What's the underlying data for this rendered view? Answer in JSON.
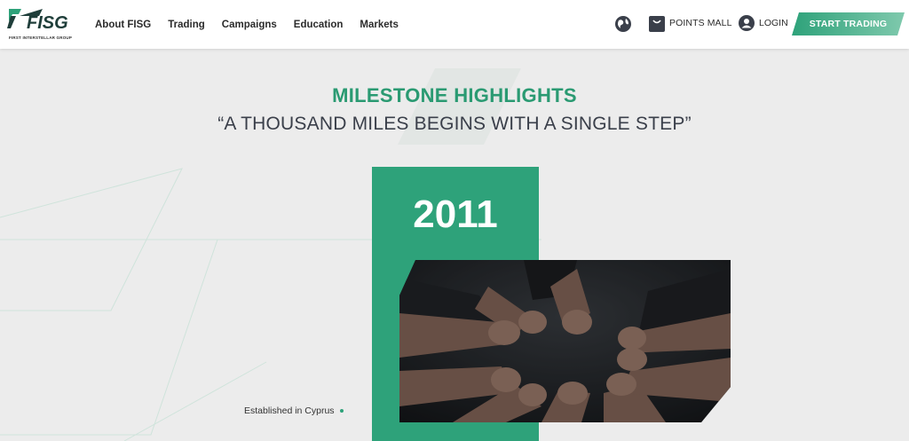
{
  "header": {
    "logo_text": "FISG",
    "logo_subtitle": "FIRST INTERSTELLAR GROUP",
    "nav": [
      {
        "label": "About FISG"
      },
      {
        "label": "Trading"
      },
      {
        "label": "Campaigns"
      },
      {
        "label": "Education"
      },
      {
        "label": "Markets"
      }
    ],
    "points_mall_label": "POINTS MALL",
    "login_label": "LOGIN",
    "start_trading_label": "START TRADING",
    "icons": {
      "language": "globe-icon",
      "points": "shopping-bag-icon",
      "login": "user-icon"
    }
  },
  "main": {
    "title": "MILESTONE HIGHLIGHTS",
    "subtitle": "“A THOUSAND MILES BEGINS WITH A SINGLE STEP”",
    "milestone": {
      "year": "2011",
      "caption": "Established in Cyprus",
      "image": "team-hands-fist-bump"
    }
  },
  "colors": {
    "accent": "#2ea27a",
    "title_green": "#2a9a72",
    "button_gradient_start": "#2ea27a",
    "button_gradient_end": "#7fc9ad",
    "background": "#ececec",
    "text_dark": "#3a3f4a"
  }
}
